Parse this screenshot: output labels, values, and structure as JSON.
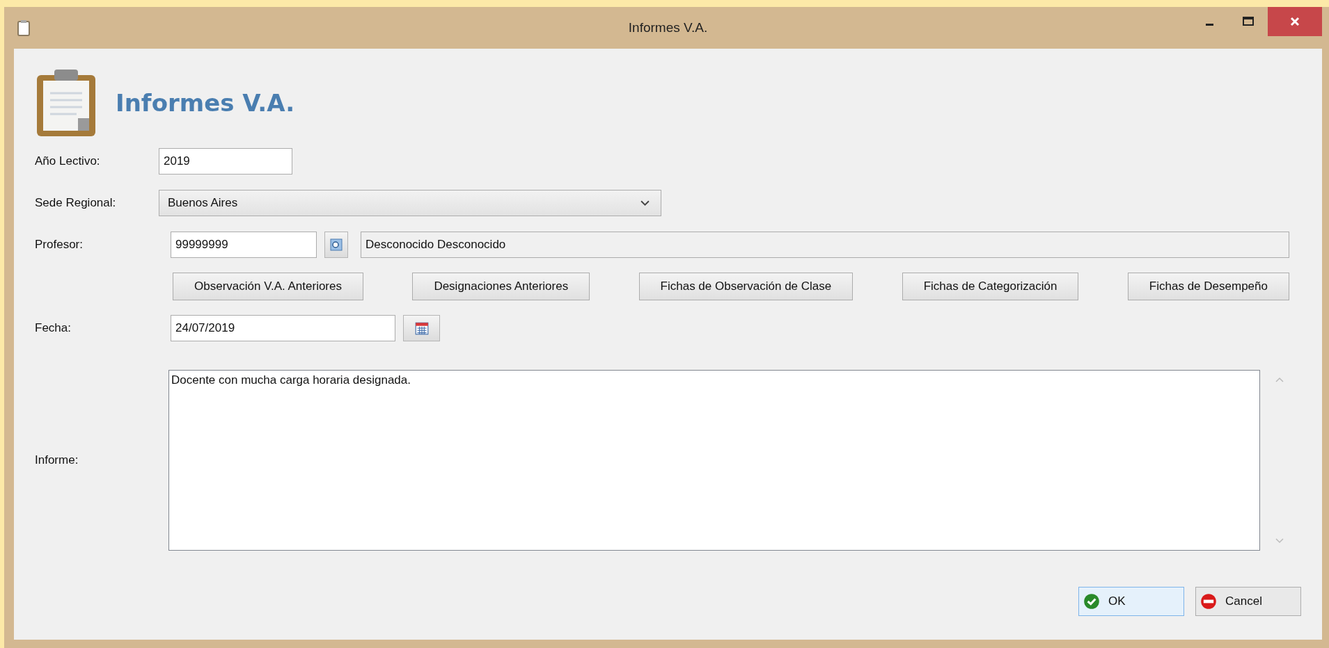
{
  "window": {
    "title": "Informes V.A."
  },
  "header": {
    "title": "Informes V.A."
  },
  "anio": {
    "label": "Año Lectivo:",
    "value": "2019"
  },
  "sede": {
    "label": "Sede Regional:",
    "value": "Buenos Aires"
  },
  "profesor": {
    "label": "Profesor:",
    "id": "99999999",
    "name": "Desconocido Desconocido"
  },
  "actions": [
    "Observación V.A. Anteriores",
    "Designaciones Anteriores",
    "Fichas de Observación de Clase",
    "Fichas de Categorización",
    "Fichas de Desempeño"
  ],
  "fecha": {
    "label": "Fecha:",
    "value": "24/07/2019"
  },
  "informe": {
    "label": "Informe:",
    "value": "Docente con mucha carga horaria designada."
  },
  "buttons": [
    {
      "kind": "ok",
      "label": "OK",
      "selected": true
    },
    {
      "kind": "cancel",
      "label": "Cancel",
      "selected": false
    }
  ]
}
